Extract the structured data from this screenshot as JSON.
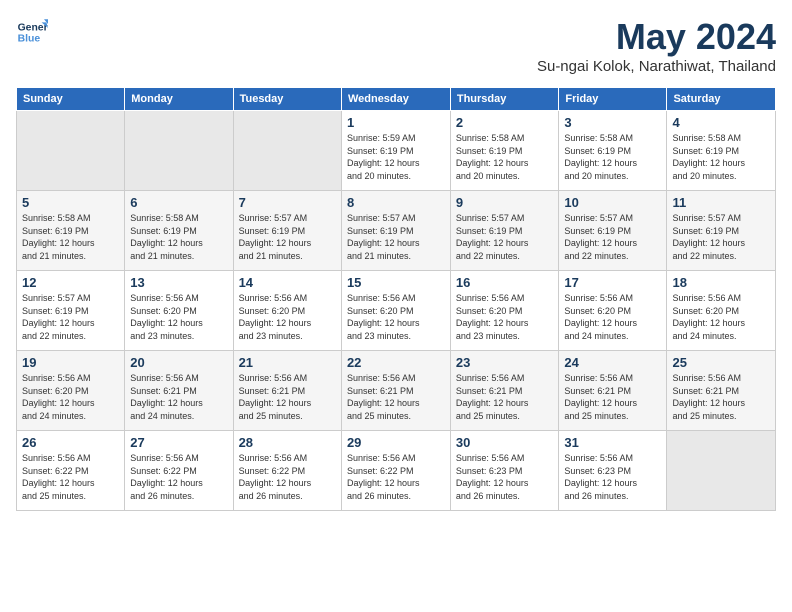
{
  "logo": {
    "line1": "General",
    "line2": "Blue"
  },
  "title": "May 2024",
  "subtitle": "Su-ngai Kolok, Narathiwat, Thailand",
  "headers": [
    "Sunday",
    "Monday",
    "Tuesday",
    "Wednesday",
    "Thursday",
    "Friday",
    "Saturday"
  ],
  "weeks": [
    [
      {
        "day": "",
        "detail": ""
      },
      {
        "day": "",
        "detail": ""
      },
      {
        "day": "",
        "detail": ""
      },
      {
        "day": "1",
        "detail": "Sunrise: 5:59 AM\nSunset: 6:19 PM\nDaylight: 12 hours\nand 20 minutes."
      },
      {
        "day": "2",
        "detail": "Sunrise: 5:58 AM\nSunset: 6:19 PM\nDaylight: 12 hours\nand 20 minutes."
      },
      {
        "day": "3",
        "detail": "Sunrise: 5:58 AM\nSunset: 6:19 PM\nDaylight: 12 hours\nand 20 minutes."
      },
      {
        "day": "4",
        "detail": "Sunrise: 5:58 AM\nSunset: 6:19 PM\nDaylight: 12 hours\nand 20 minutes."
      }
    ],
    [
      {
        "day": "5",
        "detail": "Sunrise: 5:58 AM\nSunset: 6:19 PM\nDaylight: 12 hours\nand 21 minutes."
      },
      {
        "day": "6",
        "detail": "Sunrise: 5:58 AM\nSunset: 6:19 PM\nDaylight: 12 hours\nand 21 minutes."
      },
      {
        "day": "7",
        "detail": "Sunrise: 5:57 AM\nSunset: 6:19 PM\nDaylight: 12 hours\nand 21 minutes."
      },
      {
        "day": "8",
        "detail": "Sunrise: 5:57 AM\nSunset: 6:19 PM\nDaylight: 12 hours\nand 21 minutes."
      },
      {
        "day": "9",
        "detail": "Sunrise: 5:57 AM\nSunset: 6:19 PM\nDaylight: 12 hours\nand 22 minutes."
      },
      {
        "day": "10",
        "detail": "Sunrise: 5:57 AM\nSunset: 6:19 PM\nDaylight: 12 hours\nand 22 minutes."
      },
      {
        "day": "11",
        "detail": "Sunrise: 5:57 AM\nSunset: 6:19 PM\nDaylight: 12 hours\nand 22 minutes."
      }
    ],
    [
      {
        "day": "12",
        "detail": "Sunrise: 5:57 AM\nSunset: 6:19 PM\nDaylight: 12 hours\nand 22 minutes."
      },
      {
        "day": "13",
        "detail": "Sunrise: 5:56 AM\nSunset: 6:20 PM\nDaylight: 12 hours\nand 23 minutes."
      },
      {
        "day": "14",
        "detail": "Sunrise: 5:56 AM\nSunset: 6:20 PM\nDaylight: 12 hours\nand 23 minutes."
      },
      {
        "day": "15",
        "detail": "Sunrise: 5:56 AM\nSunset: 6:20 PM\nDaylight: 12 hours\nand 23 minutes."
      },
      {
        "day": "16",
        "detail": "Sunrise: 5:56 AM\nSunset: 6:20 PM\nDaylight: 12 hours\nand 23 minutes."
      },
      {
        "day": "17",
        "detail": "Sunrise: 5:56 AM\nSunset: 6:20 PM\nDaylight: 12 hours\nand 24 minutes."
      },
      {
        "day": "18",
        "detail": "Sunrise: 5:56 AM\nSunset: 6:20 PM\nDaylight: 12 hours\nand 24 minutes."
      }
    ],
    [
      {
        "day": "19",
        "detail": "Sunrise: 5:56 AM\nSunset: 6:20 PM\nDaylight: 12 hours\nand 24 minutes."
      },
      {
        "day": "20",
        "detail": "Sunrise: 5:56 AM\nSunset: 6:21 PM\nDaylight: 12 hours\nand 24 minutes."
      },
      {
        "day": "21",
        "detail": "Sunrise: 5:56 AM\nSunset: 6:21 PM\nDaylight: 12 hours\nand 25 minutes."
      },
      {
        "day": "22",
        "detail": "Sunrise: 5:56 AM\nSunset: 6:21 PM\nDaylight: 12 hours\nand 25 minutes."
      },
      {
        "day": "23",
        "detail": "Sunrise: 5:56 AM\nSunset: 6:21 PM\nDaylight: 12 hours\nand 25 minutes."
      },
      {
        "day": "24",
        "detail": "Sunrise: 5:56 AM\nSunset: 6:21 PM\nDaylight: 12 hours\nand 25 minutes."
      },
      {
        "day": "25",
        "detail": "Sunrise: 5:56 AM\nSunset: 6:21 PM\nDaylight: 12 hours\nand 25 minutes."
      }
    ],
    [
      {
        "day": "26",
        "detail": "Sunrise: 5:56 AM\nSunset: 6:22 PM\nDaylight: 12 hours\nand 25 minutes."
      },
      {
        "day": "27",
        "detail": "Sunrise: 5:56 AM\nSunset: 6:22 PM\nDaylight: 12 hours\nand 26 minutes."
      },
      {
        "day": "28",
        "detail": "Sunrise: 5:56 AM\nSunset: 6:22 PM\nDaylight: 12 hours\nand 26 minutes."
      },
      {
        "day": "29",
        "detail": "Sunrise: 5:56 AM\nSunset: 6:22 PM\nDaylight: 12 hours\nand 26 minutes."
      },
      {
        "day": "30",
        "detail": "Sunrise: 5:56 AM\nSunset: 6:23 PM\nDaylight: 12 hours\nand 26 minutes."
      },
      {
        "day": "31",
        "detail": "Sunrise: 5:56 AM\nSunset: 6:23 PM\nDaylight: 12 hours\nand 26 minutes."
      },
      {
        "day": "",
        "detail": ""
      }
    ]
  ]
}
